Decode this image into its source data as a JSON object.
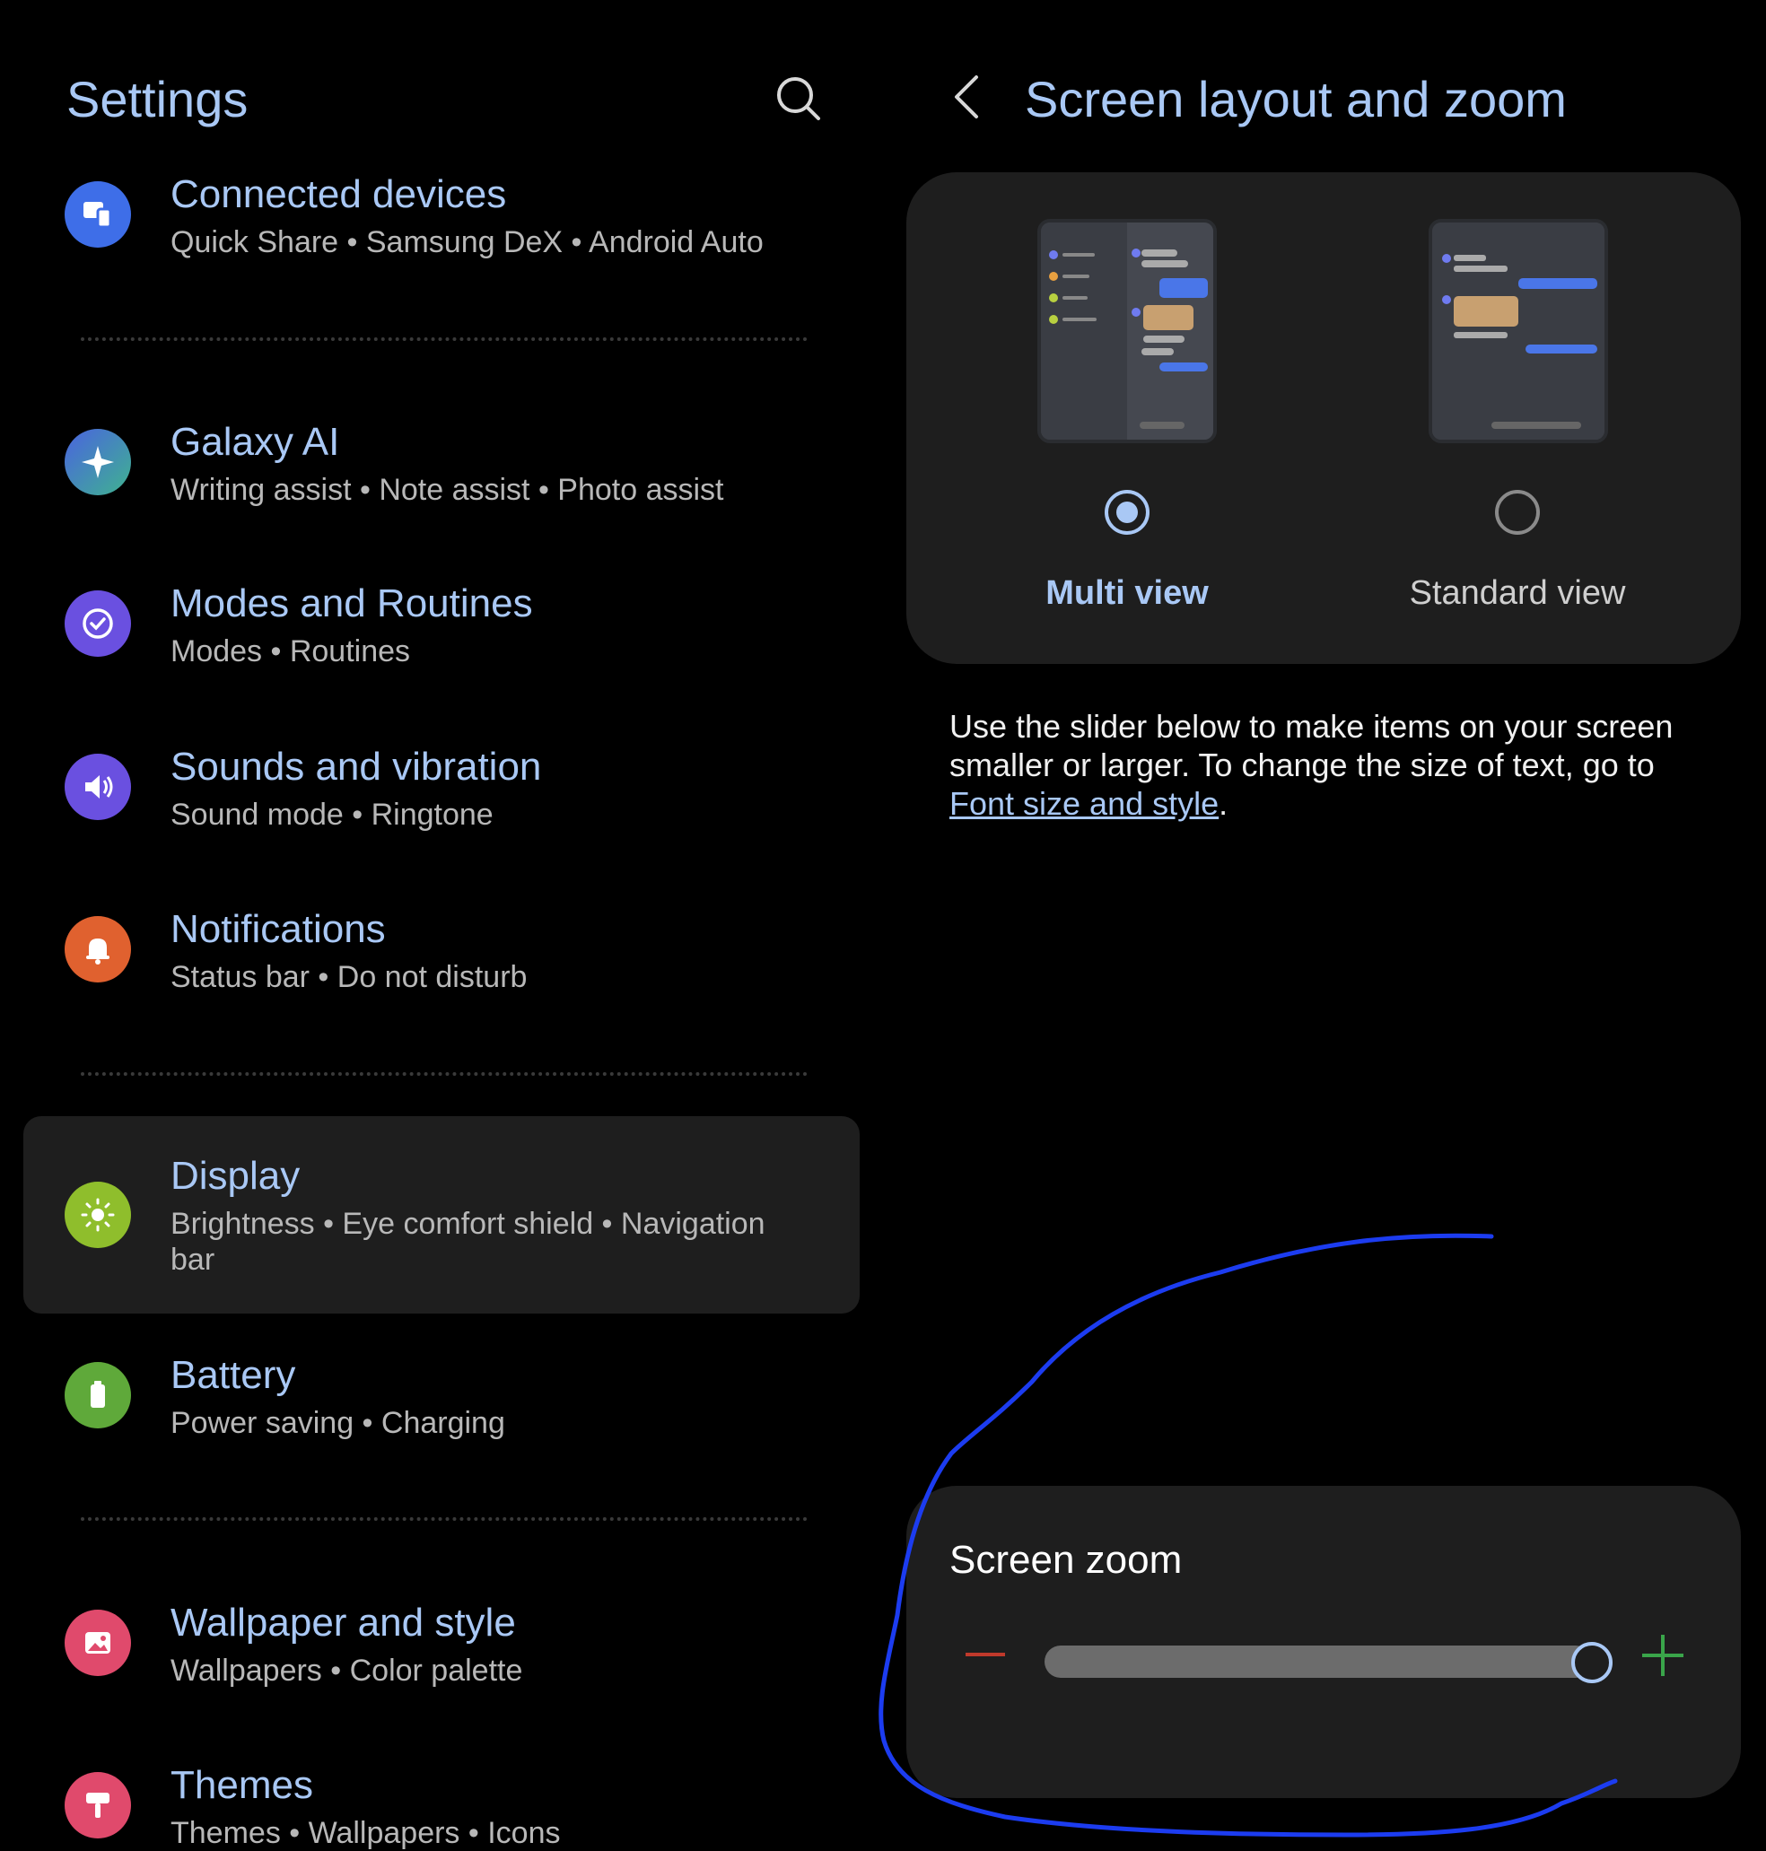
{
  "settings": {
    "title": "Settings",
    "items": [
      {
        "id": "connected",
        "title": "Connected devices",
        "subtitle": "Quick Share  •  Samsung DeX  •  Android Auto",
        "icon": "connected-devices-icon",
        "color": "#3e6ee8"
      },
      {
        "id": "galaxy-ai",
        "title": "Galaxy AI",
        "subtitle": "Writing assist  •  Note assist  •  Photo assist",
        "icon": "sparkle-icon",
        "color": "#4a63e0"
      },
      {
        "id": "modes",
        "title": "Modes and Routines",
        "subtitle": "Modes  •  Routines",
        "icon": "check-circle-icon",
        "color": "#6a50e0"
      },
      {
        "id": "sounds",
        "title": "Sounds and vibration",
        "subtitle": "Sound mode  •  Ringtone",
        "icon": "speaker-icon",
        "color": "#6a50e0"
      },
      {
        "id": "notifications",
        "title": "Notifications",
        "subtitle": "Status bar  •  Do not disturb",
        "icon": "bell-icon",
        "color": "#e0612f"
      },
      {
        "id": "display",
        "title": "Display",
        "subtitle": "Brightness  •  Eye comfort shield  •  Navigation bar",
        "icon": "sun-icon",
        "color": "#8fbe2c"
      },
      {
        "id": "battery",
        "title": "Battery",
        "subtitle": "Power saving  •  Charging",
        "icon": "battery-icon",
        "color": "#5fa93a"
      },
      {
        "id": "wallpaper",
        "title": "Wallpaper and style",
        "subtitle": "Wallpapers  •  Color palette",
        "icon": "image-icon",
        "color": "#e04a6c"
      },
      {
        "id": "themes",
        "title": "Themes",
        "subtitle": "Themes  •  Wallpapers  •  Icons",
        "icon": "brush-icon",
        "color": "#e04a6c"
      }
    ]
  },
  "detail": {
    "title": "Screen layout and zoom",
    "views": [
      {
        "label": "Multi view",
        "selected": true
      },
      {
        "label": "Standard view",
        "selected": false
      }
    ],
    "description_before": "Use the slider below to make items on your screen smaller or larger. To change the size of text, go to ",
    "description_link": "Font size and style",
    "description_after": ".",
    "zoom": {
      "title": "Screen zoom",
      "level": 1.0
    }
  },
  "colors": {
    "accent": "#a9c8f5",
    "card": "#1e1e1e",
    "minus": "#c0392b",
    "plus": "#3aa54a",
    "annotation": "#1c3cf0"
  }
}
